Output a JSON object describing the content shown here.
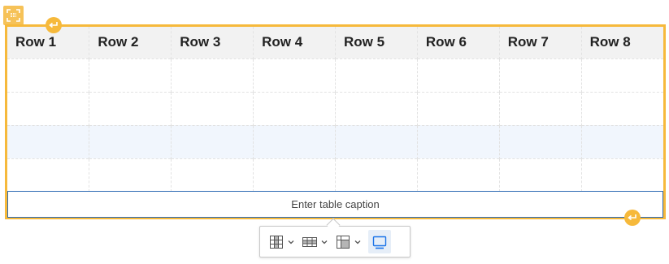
{
  "table": {
    "headers": [
      "Row 1",
      "Row 2",
      "Row 3",
      "Row 4",
      "Row 5",
      "Row 6",
      "Row 7",
      "Row 8"
    ],
    "rows": [
      [
        "",
        "",
        "",
        "",
        "",
        "",
        "",
        ""
      ],
      [
        "",
        "",
        "",
        "",
        "",
        "",
        "",
        ""
      ],
      [
        "",
        "",
        "",
        "",
        "",
        "",
        "",
        ""
      ],
      [
        "",
        "",
        "",
        "",
        "",
        "",
        "",
        ""
      ]
    ],
    "highlighted_row_index": 2,
    "caption_placeholder": "Enter table caption"
  },
  "toolbar": {
    "buttons": [
      {
        "icon": "table-column-icon",
        "has_dropdown": true
      },
      {
        "icon": "table-row-icon",
        "has_dropdown": true
      },
      {
        "icon": "table-merge-cells-icon",
        "has_dropdown": true
      },
      {
        "icon": "toggle-caption-icon",
        "has_dropdown": false,
        "active": true
      }
    ]
  },
  "colors": {
    "widget_outline": "#f6b93b",
    "caption_border": "#2d6ab3",
    "header_bg": "#f2f2f2",
    "highlight_row_bg": "#f1f6fd",
    "active_button": "#1a73e8"
  }
}
